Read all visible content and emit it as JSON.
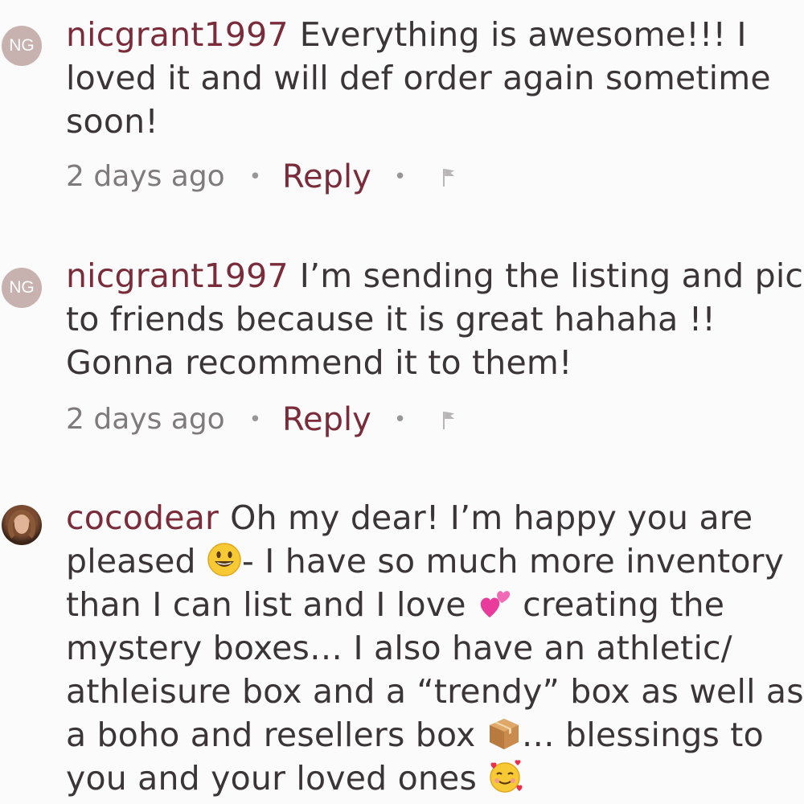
{
  "comments": [
    {
      "avatar": "NG",
      "username": "nicgrant1997",
      "text": "Everything is awesome!!! I loved it and will def order again sometime soon!",
      "time": "2 days ago",
      "reply_label": "Reply",
      "separator": "•",
      "flag_icon": "flag-icon"
    },
    {
      "avatar": "NG",
      "username": "nicgrant1997",
      "text": "I’m sending the listing and pics to friends because it is great hahaha !! Gonna recommend it to them!",
      "time": "2 days ago",
      "reply_label": "Reply",
      "separator": "•",
      "flag_icon": "flag-icon"
    },
    {
      "avatar_icon": "profile-photo",
      "username": "cocodear",
      "text_parts": {
        "p1": "Oh my dear! I’m happy you are pleased ",
        "e1": "smiley-face-emoji",
        "p2": "- I have so much more inventory than I can list and I love ",
        "e2": "two-hearts-emoji",
        "p3": " creating the mystery boxes… I also have an athletic/ athleisure box and a “trendy” box as well as a boho and resellers box ",
        "e3": "package-emoji",
        "p4": "… blessings to you and your loved ones ",
        "e4": "smiling-face-with-hearts-emoji"
      }
    }
  ],
  "colors": {
    "username": "#7b2c3a",
    "body_text": "#3b3537",
    "meta_text": "#7f7b7c",
    "avatar_bg": "#c7b2b0",
    "background": "#fbfbfb"
  }
}
